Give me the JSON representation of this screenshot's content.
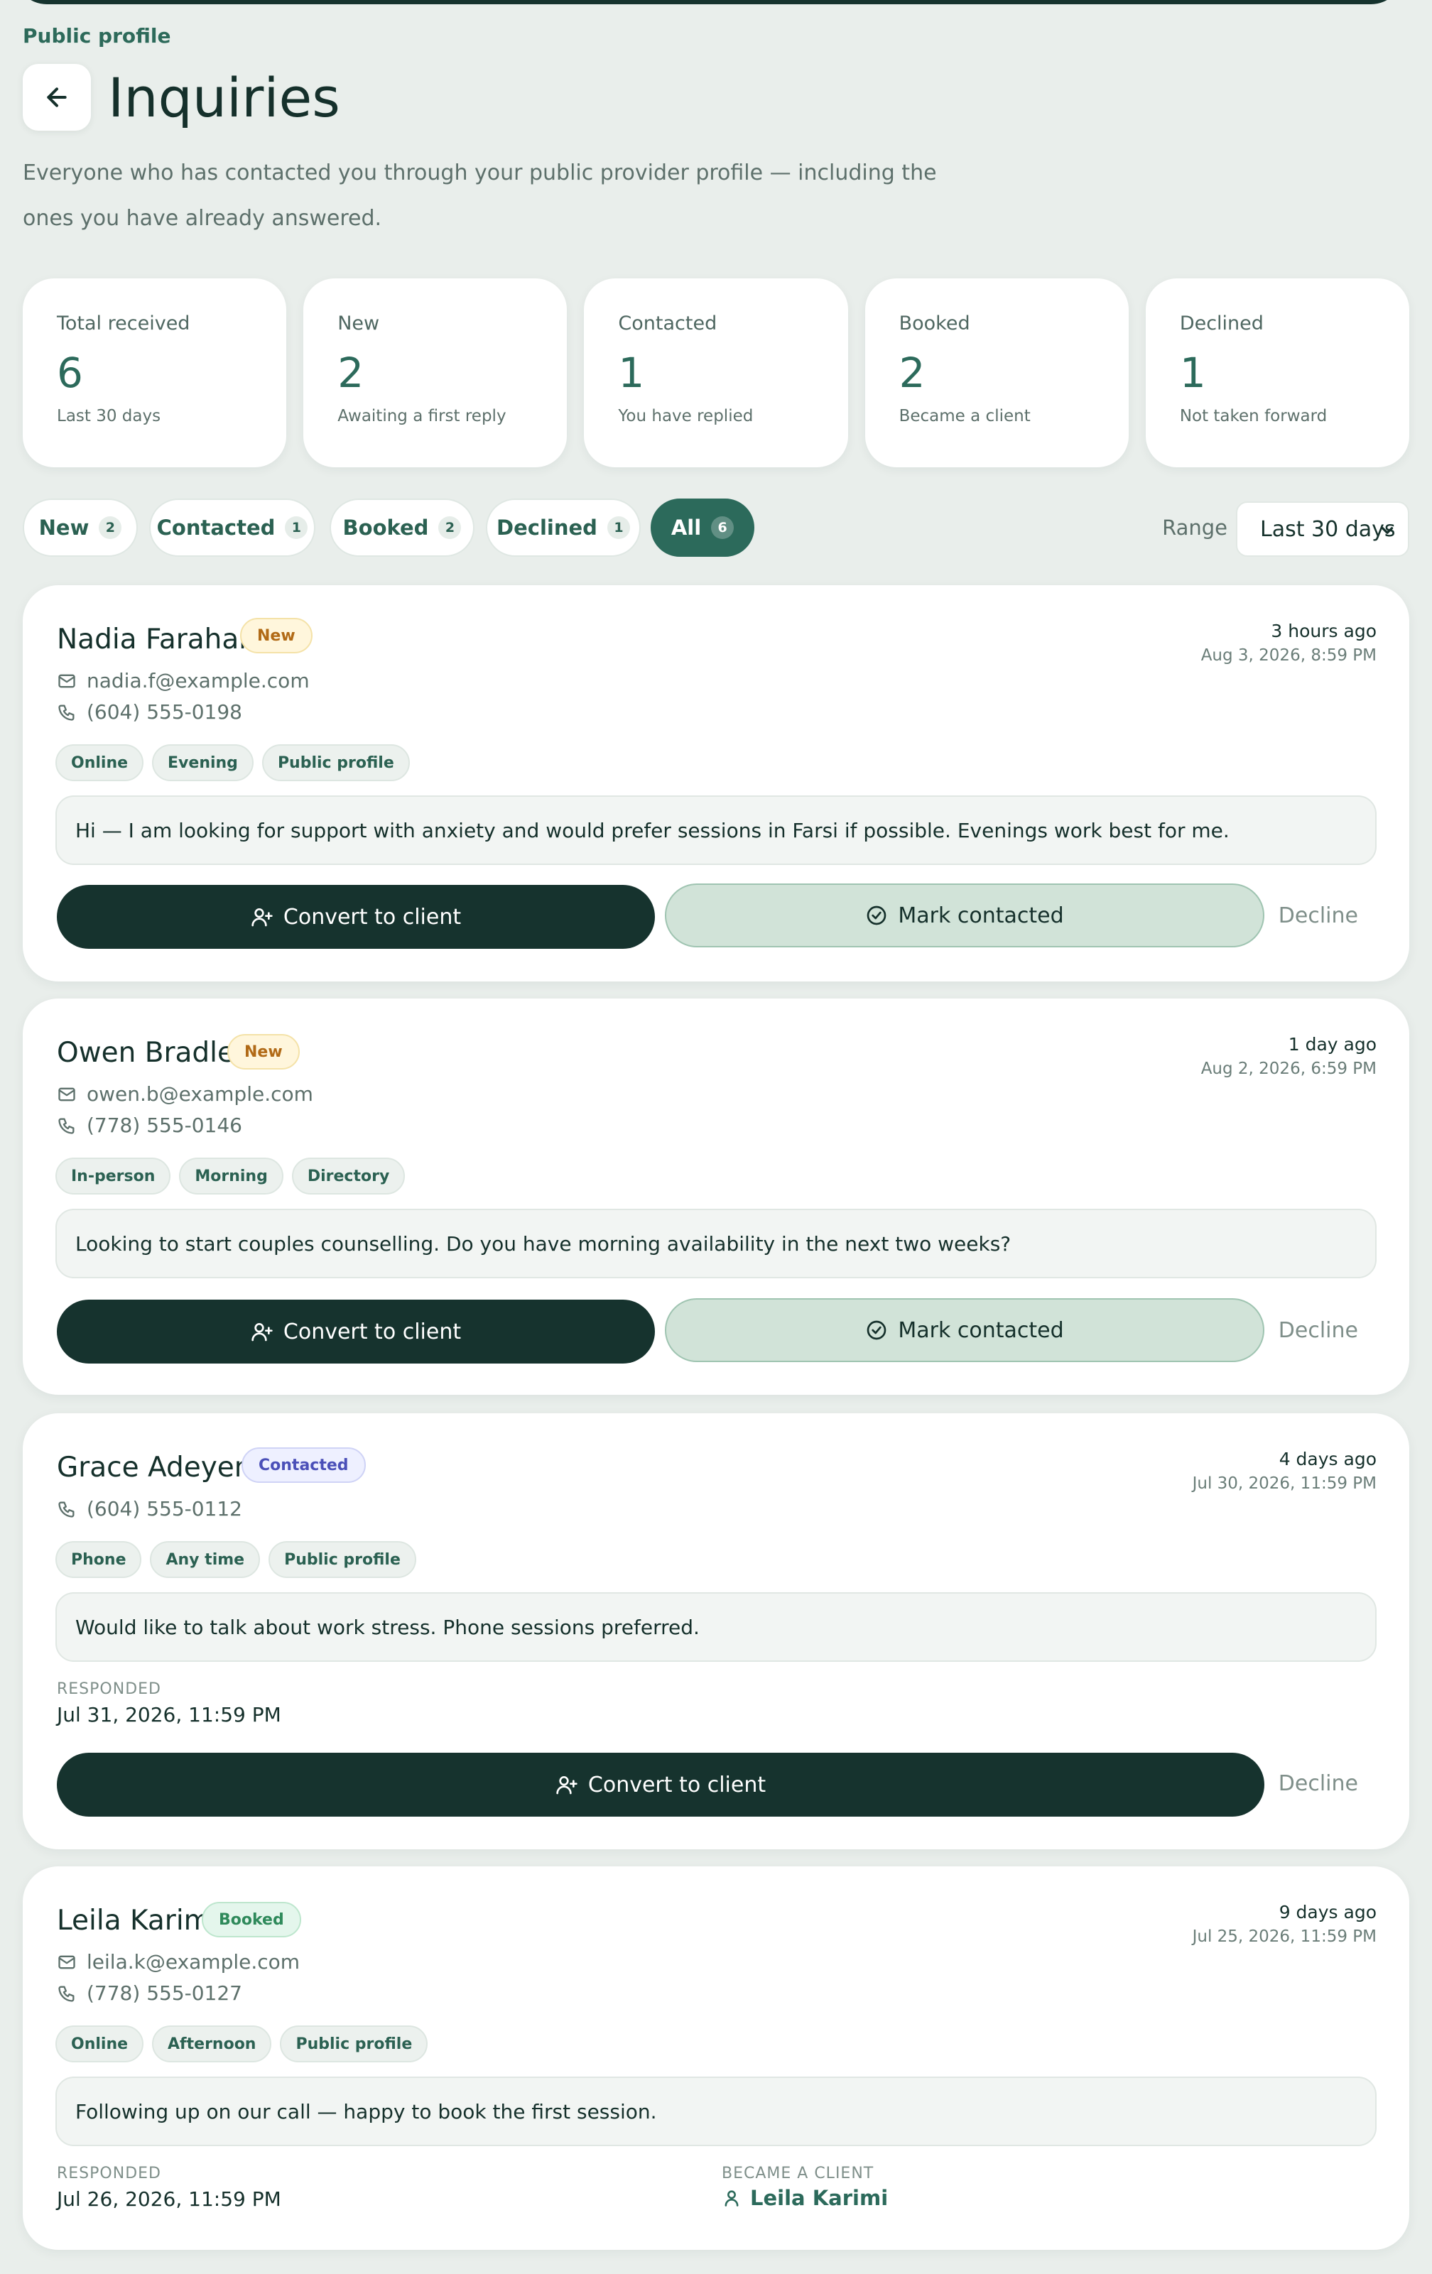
{
  "header": {
    "eyebrow": "Public profile",
    "title": "Inquiries",
    "description": "Everyone who has contacted you through your public provider profile — including the ones you have already answered."
  },
  "stats": [
    {
      "label": "Total received",
      "value": "6",
      "sub": "Last 30 days"
    },
    {
      "label": "New",
      "value": "2",
      "sub": "Awaiting a first reply"
    },
    {
      "label": "Contacted",
      "value": "1",
      "sub": "You have replied"
    },
    {
      "label": "Booked",
      "value": "2",
      "sub": "Became a client"
    },
    {
      "label": "Declined",
      "value": "1",
      "sub": "Not taken forward"
    }
  ],
  "filters": {
    "chips": [
      {
        "label": "New",
        "count": "2"
      },
      {
        "label": "Contacted",
        "count": "1"
      },
      {
        "label": "Booked",
        "count": "2"
      },
      {
        "label": "Declined",
        "count": "1"
      },
      {
        "label": "All",
        "count": "6"
      }
    ],
    "range_label": "Range",
    "range_value": "Last 30 days"
  },
  "inquiries": [
    {
      "name": "Nadia Farahani",
      "status": "New",
      "time_relative": "3 hours ago",
      "time_absolute": "Aug 3, 2026, 8:59 PM",
      "email": "nadia.f@example.com",
      "phone": "(604) 555-0198",
      "tags": [
        "Online",
        "Evening",
        "Public profile"
      ],
      "message": "Hi — I am looking for support with anxiety and would prefer sessions in Farsi if possible. Evenings work best for me."
    },
    {
      "name": "Owen Bradley",
      "status": "New",
      "time_relative": "1 day ago",
      "time_absolute": "Aug 2, 2026, 6:59 PM",
      "email": "owen.b@example.com",
      "phone": "(778) 555-0146",
      "tags": [
        "In-person",
        "Morning",
        "Directory"
      ],
      "message": "Looking to start couples counselling. Do you have morning availability in the next two weeks?"
    },
    {
      "name": "Grace Adeyemi",
      "status": "Contacted",
      "time_relative": "4 days ago",
      "time_absolute": "Jul 30, 2026, 11:59 PM",
      "phone": "(604) 555-0112",
      "tags": [
        "Phone",
        "Any time",
        "Public profile"
      ],
      "message": "Would like to talk about work stress. Phone sessions preferred.",
      "responded_label": "RESPONDED",
      "responded_value": "Jul 31, 2026, 11:59 PM"
    },
    {
      "name": "Leila Karimi",
      "status": "Booked",
      "time_relative": "9 days ago",
      "time_absolute": "Jul 25, 2026, 11:59 PM",
      "email": "leila.k@example.com",
      "phone": "(778) 555-0127",
      "tags": [
        "Online",
        "Afternoon",
        "Public profile"
      ],
      "message": "Following up on our call — happy to book the first session.",
      "responded_label": "RESPONDED",
      "responded_value": "Jul 26, 2026, 11:59 PM",
      "client_label": "BECAME A CLIENT",
      "client_value": "Leila Karimi"
    }
  ],
  "actions": {
    "convert": "Convert to client",
    "mark": "Mark contacted",
    "decline": "Decline"
  },
  "colors": {
    "accent": "#2c6a5b",
    "dark": "#16332e",
    "background": "#e9eeeb"
  }
}
